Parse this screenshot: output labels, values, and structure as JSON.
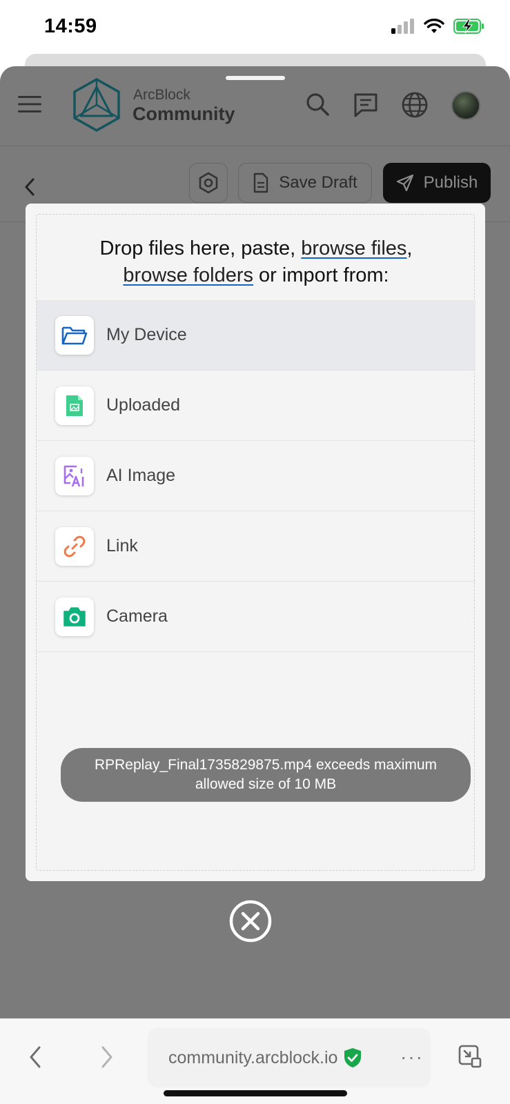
{
  "status_bar": {
    "time": "14:59"
  },
  "header": {
    "brand_small": "ArcBlock",
    "brand_big": "Community"
  },
  "toolbar": {
    "save_draft_label": "Save Draft",
    "publish_label": "Publish"
  },
  "upload": {
    "title_part1": "Drop files here, paste, ",
    "browse_files": "browse files",
    "comma": ",",
    "browse_folders": "browse folders",
    "title_part2": " or import from:",
    "sources": [
      {
        "label": "My Device",
        "icon": "folder-icon",
        "color": "#1565c0"
      },
      {
        "label": "Uploaded",
        "icon": "image-file-icon",
        "color": "#3ecf8e"
      },
      {
        "label": "AI Image",
        "icon": "ai-image-icon",
        "color": "#a66ef0"
      },
      {
        "label": "Link",
        "icon": "link-icon",
        "color": "#f0794a"
      },
      {
        "label": "Camera",
        "icon": "camera-icon",
        "color": "#0fb27f"
      }
    ],
    "toast_line1": "RPReplay_Final1735829875.mp4 exceeds maximum",
    "toast_line2": "allowed size of 10 MB"
  },
  "browser": {
    "url": "community.arcblock.io",
    "more": "···"
  }
}
